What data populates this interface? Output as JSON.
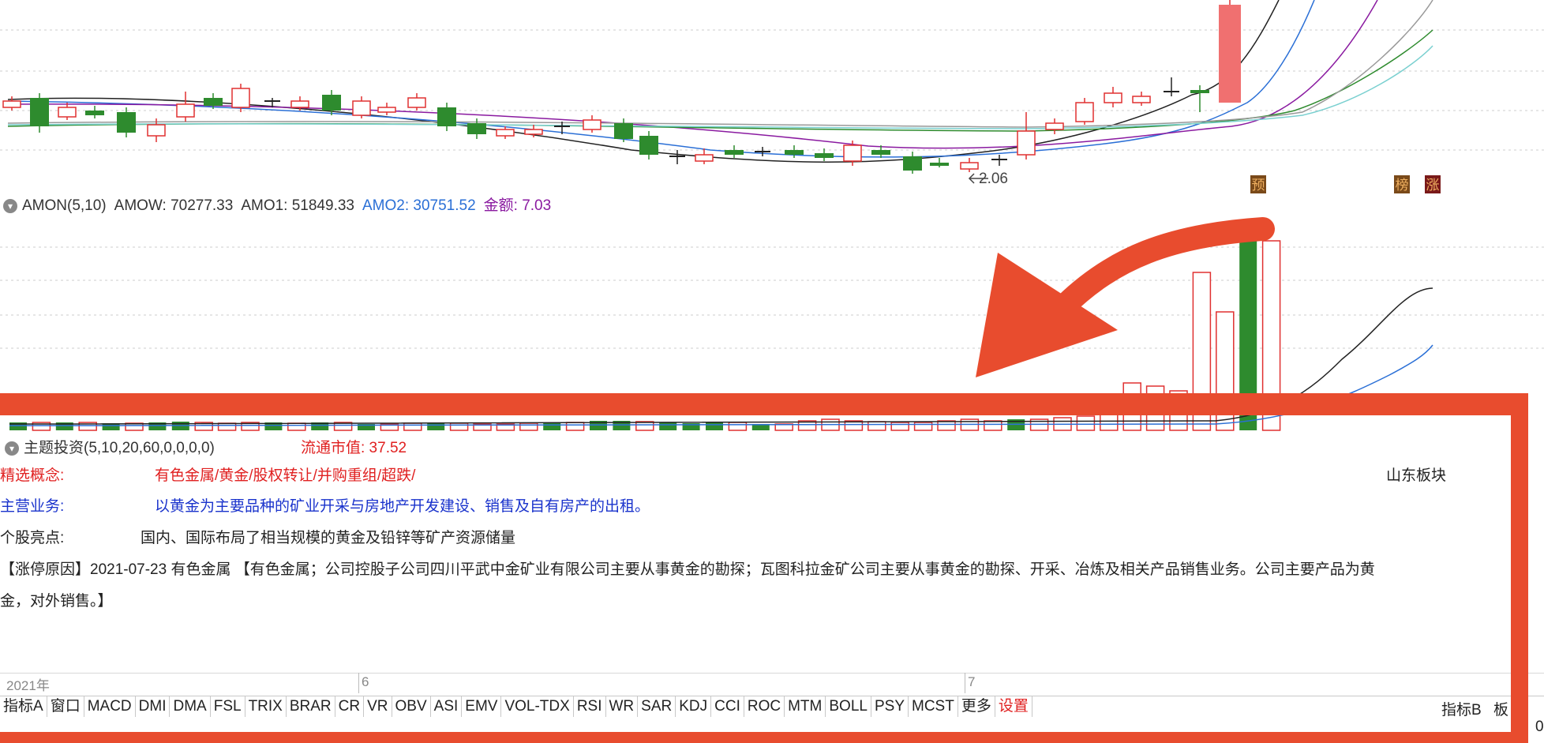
{
  "price_chart": {
    "low_marker": "2.06",
    "badges": [
      "预",
      "榜",
      "涨"
    ]
  },
  "volume_indicator": {
    "name": "AMON(5,10)",
    "amow": "AMOW: 70277.33",
    "amo1": "AMO1: 51849.33",
    "amo2": "AMO2: 30751.52",
    "amount": "金额: 7.03"
  },
  "theme_panel": {
    "header": "主题投资(5,10,20,60,0,0,0,0)",
    "circulating_cap": "流通市值: 37.52",
    "concept_label": "精选概念:",
    "concept_value": "有色金属/黄金/股权转让/并购重组/超跌/",
    "region": "山东板块",
    "business_label": "主营业务:",
    "business_value": "以黄金为主要品种的矿业开采与房地产开发建设、销售及自有房产的出租。",
    "highlight_label": "个股亮点:",
    "highlight_value": "国内、国际布局了相当规模的黄金及铅锌等矿产资源储量",
    "limit_reason_line1": "【涨停原因】2021-07-23 有色金属 【有色金属；公司控股子公司四川平武中金矿业有限公司主要从事黄金的勘探；瓦图科拉金矿公司主要从事黄金的勘探、开采、冶炼及相关产品销售业务。公司主要产品为黄",
    "limit_reason_line2": "金，对外销售。】"
  },
  "time_axis": {
    "year": "2021年",
    "month_6": "6",
    "month_7": "7",
    "right_digit": "0"
  },
  "tabs": [
    "指标A",
    "窗口",
    "MACD",
    "DMI",
    "DMA",
    "FSL",
    "TRIX",
    "BRAR",
    "CR",
    "VR",
    "OBV",
    "ASI",
    "EMV",
    "VOL-TDX",
    "RSI",
    "WR",
    "SAR",
    "KDJ",
    "CCI",
    "ROC",
    "MTM",
    "BOLL",
    "PSY",
    "MCST",
    "更多",
    "设置"
  ],
  "tabs_right": [
    "指标B",
    "板"
  ],
  "colors": {
    "up": "#e03030",
    "down": "#2e8b2e",
    "annotation": "#e84c2e",
    "concept": "#e02020",
    "business": "#1a33cc",
    "amo2": "#2a6fd6",
    "amount": "#8a1aa0"
  }
}
